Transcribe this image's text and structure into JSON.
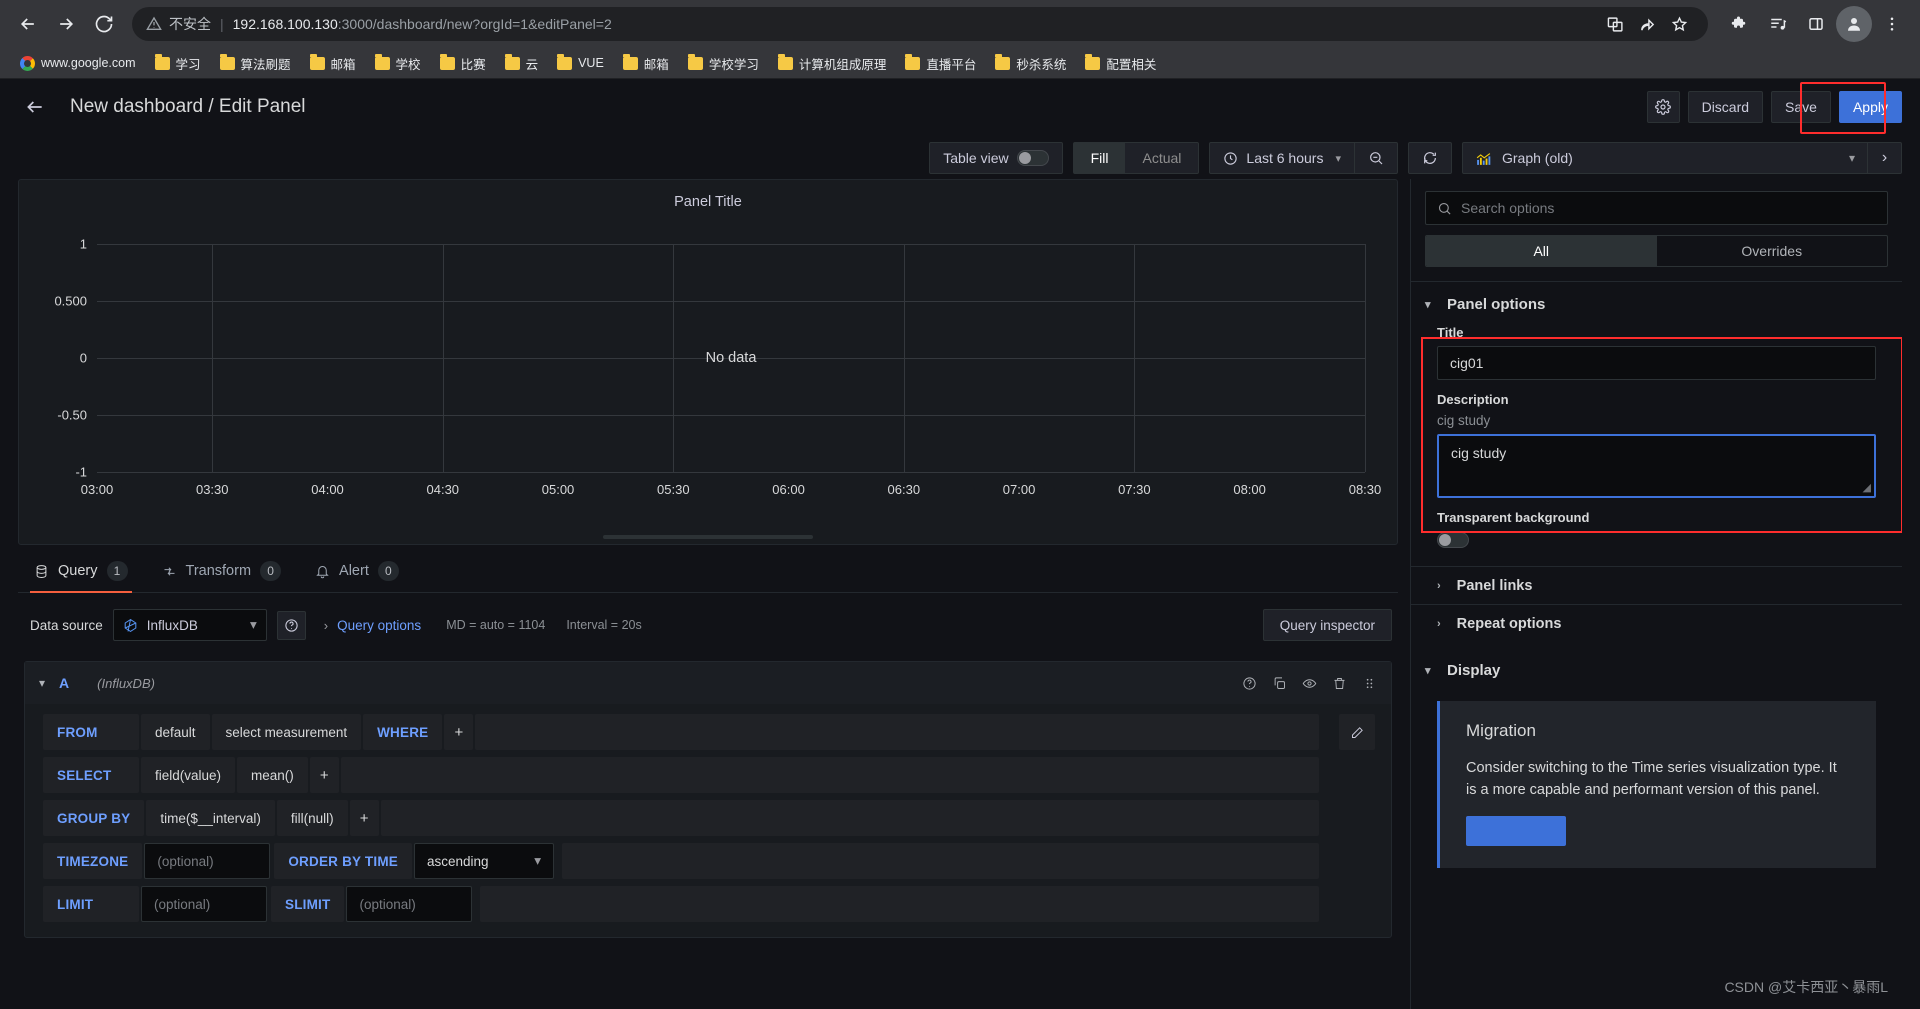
{
  "browser": {
    "security_label": "不安全",
    "url_host": "192.168.100.130",
    "url_rest": ":3000/dashboard/new?orgId=1&editPanel=2",
    "bookmarks": [
      {
        "label": "www.google.com",
        "icon": "google-logo"
      },
      {
        "label": "学习",
        "icon": "folder-icon"
      },
      {
        "label": "算法刷题",
        "icon": "folder-icon"
      },
      {
        "label": "邮箱",
        "icon": "folder-icon"
      },
      {
        "label": "学校",
        "icon": "folder-icon"
      },
      {
        "label": "比赛",
        "icon": "folder-icon"
      },
      {
        "label": "云",
        "icon": "folder-icon"
      },
      {
        "label": "VUE",
        "icon": "folder-icon"
      },
      {
        "label": "邮箱",
        "icon": "folder-icon"
      },
      {
        "label": "学校学习",
        "icon": "folder-icon"
      },
      {
        "label": "计算机组成原理",
        "icon": "folder-icon"
      },
      {
        "label": "直播平台",
        "icon": "folder-icon"
      },
      {
        "label": "秒杀系统",
        "icon": "folder-icon"
      },
      {
        "label": "配置相关",
        "icon": "folder-icon"
      }
    ]
  },
  "topbar": {
    "title": "New dashboard / Edit Panel",
    "settings_icon": "gear-icon",
    "discard_label": "Discard",
    "save_label": "Save",
    "apply_label": "Apply",
    "highlight_color": "#ff2d2d"
  },
  "panel_toolbar": {
    "table_view_label": "Table view",
    "fill_label": "Fill",
    "actual_label": "Actual",
    "time_range": "Last 6 hours",
    "clock_icon": "clock-icon",
    "zoom_out_icon": "zoom-out-icon",
    "refresh_icon": "refresh-icon",
    "viz_type": "Graph (old)",
    "viz_icon": "bar-chart-icon"
  },
  "viz_panel": {
    "title": "Panel Title",
    "no_data": "No data"
  },
  "chart_data": {
    "type": "line",
    "title": "Panel Title",
    "xlabel": "",
    "ylabel": "",
    "series": [],
    "x_ticks": [
      "03:00",
      "03:30",
      "04:00",
      "04:30",
      "05:00",
      "05:30",
      "06:00",
      "06:30",
      "07:00",
      "07:30",
      "08:00",
      "08:30"
    ],
    "y_ticks": [
      "1",
      "0.500",
      "0",
      "-0.50",
      "-1"
    ],
    "ylim": [
      -1,
      1
    ],
    "grid": true,
    "legend": "none",
    "empty_message": "No data"
  },
  "query_tabs": [
    {
      "label": "Query",
      "count": "1",
      "icon": "database-icon",
      "active": true
    },
    {
      "label": "Transform",
      "count": "0",
      "icon": "transform-icon",
      "active": false
    },
    {
      "label": "Alert",
      "count": "0",
      "icon": "bell-icon",
      "active": false
    }
  ],
  "datasource_row": {
    "label": "Data source",
    "value": "InfluxDB",
    "help_icon": "help-circle-icon",
    "query_options_label": "Query options",
    "md_text": "MD = auto = 1104",
    "interval_text": "Interval = 20s",
    "query_inspector_label": "Query inspector"
  },
  "query_card": {
    "ref_id": "A",
    "datasource": "(InfluxDB)",
    "actions": [
      "help-circle-icon",
      "copy-icon",
      "eye-icon",
      "trash-icon",
      "drag-handle-icon"
    ],
    "pencil_icon": "pencil-icon",
    "rows": [
      {
        "key": "FROM",
        "parts": [
          "default",
          "select measurement"
        ],
        "key2": "WHERE",
        "plus": "+"
      },
      {
        "key": "SELECT",
        "parts": [
          "field(value)",
          "mean()"
        ],
        "plus": "+"
      },
      {
        "key": "GROUP BY",
        "parts": [
          "time($__interval)",
          "fill(null)"
        ],
        "plus": "+"
      },
      {
        "key": "TIMEZONE",
        "input_placeholder": "(optional)",
        "key2": "ORDER BY TIME",
        "dropdown": "ascending"
      },
      {
        "key": "LIMIT",
        "input_placeholder": "(optional)",
        "key2": "SLIMIT",
        "input2_placeholder": "(optional)"
      }
    ]
  },
  "options_pane": {
    "search_placeholder": "Search options",
    "search_icon": "search-icon",
    "tab_all": "All",
    "tab_overrides": "Overrides",
    "panel_options_label": "Panel options",
    "title_label": "Title",
    "title_value": "cig01",
    "description_label": "Description",
    "description_hint": "cig study",
    "description_value": "cig study",
    "transparent_label": "Transparent background",
    "panel_links_label": "Panel links",
    "repeat_options_label": "Repeat options",
    "display_label": "Display",
    "migration_title": "Migration",
    "migration_text": "Consider switching to the Time series visualization type. It is a more capable and performant version of this panel.",
    "highlight_color": "#ff2d2d",
    "focus_color": "#3d71d9"
  },
  "watermark": "CSDN @艾卡西亚丶暴雨L"
}
